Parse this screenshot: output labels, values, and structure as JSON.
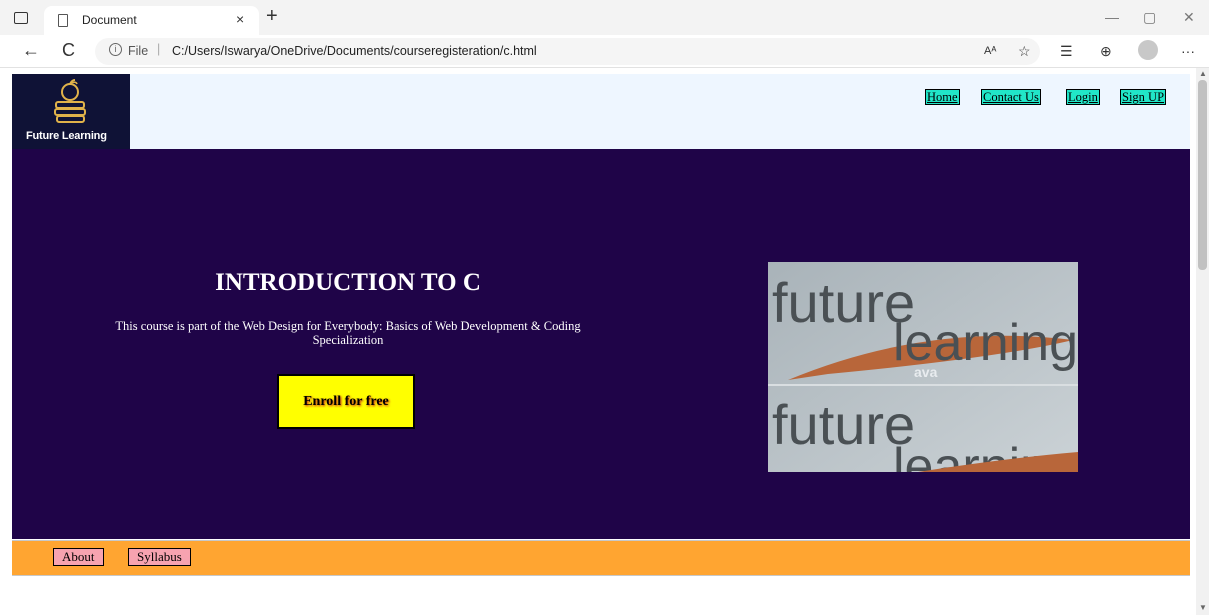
{
  "browser": {
    "tab_title": "Document",
    "close_glyph": "×",
    "new_tab_glyph": "+",
    "back_glyph": "←",
    "reload_glyph": "C",
    "file_label": "File",
    "separator": "|",
    "url_path": "C:/Users/Iswarya/OneDrive/Documents/courseregisteration/c.html",
    "read_aloud_glyph": "Aᴬ",
    "menu_glyph": "···"
  },
  "site": {
    "logo_text": "Future Learning",
    "nav": [
      "Home",
      "Contact Us",
      "Login",
      "Sign UP"
    ]
  },
  "hero": {
    "title": "INTRODUCTION TO C",
    "description": "This course is part of the Web Design for Everybody: Basics of Web Development & Coding Specialization",
    "enroll_label": "Enroll for free",
    "image_words": [
      "future",
      "learning",
      "ava"
    ]
  },
  "footer": {
    "links": [
      "About",
      "Syllabus"
    ]
  },
  "colors": {
    "header_bg": "#eef6ff",
    "logo_bg": "#0f1236",
    "nav_link_bg": "#21e6c8",
    "hero_bg": "#1f0448",
    "enroll_bg": "#ffff00",
    "footer_bg": "#ffa531",
    "footer_link_bg": "#f7a3b0"
  }
}
